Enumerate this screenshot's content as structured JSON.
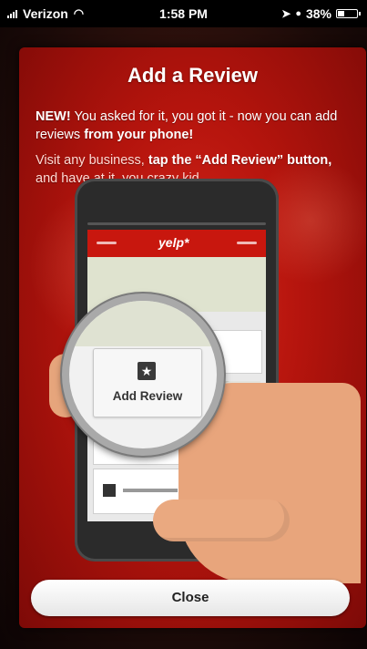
{
  "status_bar": {
    "carrier": "Verizon",
    "time": "1:58 PM",
    "battery_percent": "38%",
    "battery_level": 0.38,
    "signal_icon": "signal-bars-icon",
    "wifi_icon": "wifi-icon",
    "location_icon": "location-arrow-icon",
    "alarm_icon": "alarm-icon"
  },
  "modal": {
    "title": "Add a Review",
    "p1_new": "NEW!",
    "p1_text": " You asked for it, you got it - now you can add reviews ",
    "p1_bold": "from your phone!",
    "p2_text": "Visit any business, ",
    "p2_bold": "tap the “Add Review” button,",
    "p2_end": " and have at it, you crazy kid.",
    "illustration": {
      "button_label": "Add Review",
      "button_icon": "star-icon"
    },
    "close_label": "Close"
  },
  "colors": {
    "accent": "#c8170e",
    "background": "#1a0606"
  }
}
